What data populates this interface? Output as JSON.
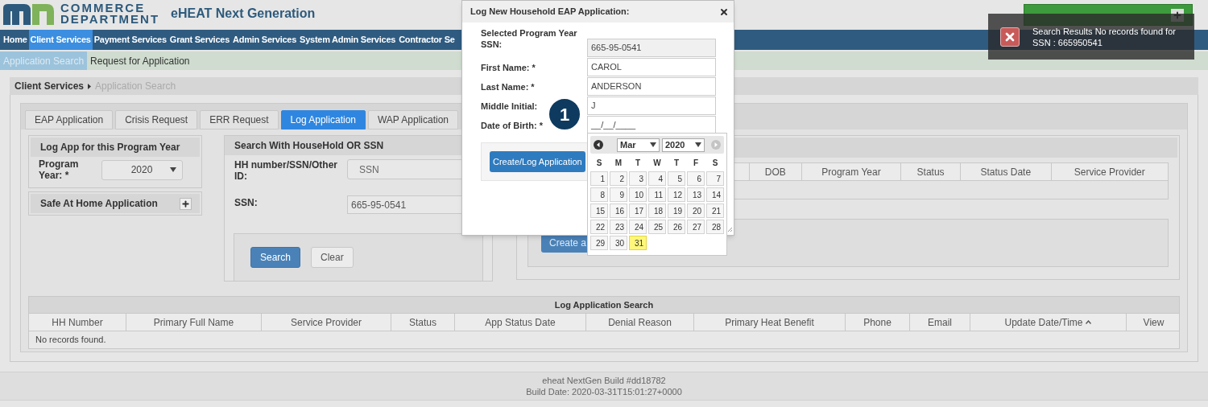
{
  "header": {
    "logo_line_1": "COMMERCE",
    "logo_line_2": "DEPARTMENT",
    "app_title": "eHEAT Next Generation"
  },
  "nav": [
    {
      "label": "Home",
      "selected": false
    },
    {
      "label": "Client Services",
      "selected": true
    },
    {
      "label": "Payment Services",
      "selected": false
    },
    {
      "label": "Grant Services",
      "selected": false
    },
    {
      "label": "Admin Services",
      "selected": false
    },
    {
      "label": "System Admin Services",
      "selected": false
    },
    {
      "label": "Contractor Se",
      "selected": false
    }
  ],
  "subnav": [
    {
      "label": "Application Search",
      "selected": true
    },
    {
      "label": "Request for Application",
      "selected": false
    }
  ],
  "breadcrumb": [
    "Client Services",
    "Application Search"
  ],
  "tabs": [
    {
      "label": "EAP Application",
      "selected": false
    },
    {
      "label": "Crisis Request",
      "selected": false
    },
    {
      "label": "ERR Request",
      "selected": false
    },
    {
      "label": "Log Application",
      "selected": true
    },
    {
      "label": "WAP Application",
      "selected": false
    }
  ],
  "program_year_panel": {
    "title": "Log App for this Program Year",
    "label": "Program Year: *",
    "value": "2020"
  },
  "safe_at_home": {
    "title": "Safe At Home Application",
    "expanded": false
  },
  "search_panel": {
    "title": "Search With HouseHold OR SSN",
    "id_label": "HH number/SSN/Other ID:",
    "id_value": "SSN",
    "ssn_label": "SSN:",
    "ssn_value": "665-95-0541",
    "buttons": [
      {
        "label": "Search",
        "kind": "primary"
      },
      {
        "label": "Clear",
        "kind": "default"
      }
    ]
  },
  "results_panel": {
    "columns": [
      "DOB",
      "Program Year",
      "Status",
      "Status Date",
      "Service Provider"
    ],
    "button": "Create a"
  },
  "log_table": {
    "title": "Log Application Search",
    "columns": [
      {
        "label": "HH Number",
        "sorted": false
      },
      {
        "label": "Primary Full Name",
        "sorted": false
      },
      {
        "label": "Service Provider",
        "sorted": false
      },
      {
        "label": "Status",
        "sorted": false
      },
      {
        "label": "App Status Date",
        "sorted": false
      },
      {
        "label": "Denial Reason",
        "sorted": false
      },
      {
        "label": "Primary Heat Benefit",
        "sorted": false
      },
      {
        "label": "Phone",
        "sorted": false
      },
      {
        "label": "Email",
        "sorted": false
      },
      {
        "label": "Update Date/Time",
        "sorted": true
      },
      {
        "label": "View",
        "sorted": false
      }
    ],
    "empty_message": "No records found."
  },
  "footer": [
    "eheat NextGen Build #dd18782",
    "Build Date: 2020-03-31T15:01:27+0000"
  ],
  "modal": {
    "title": "Log New Household EAP Application:",
    "fields": [
      {
        "label": "Selected Program Year SSN:",
        "value": "665-95-0541",
        "readonly": true
      },
      {
        "label": "First Name: *",
        "value": "CAROL",
        "readonly": false
      },
      {
        "label": "Last Name: *",
        "value": "ANDERSON",
        "readonly": false
      },
      {
        "label": "Middle Initial:",
        "value": "J",
        "readonly": false
      },
      {
        "label": "Date of Birth: *",
        "value": "__/__/____",
        "readonly": false
      }
    ],
    "submit": "Create/Log Application",
    "step_badge": "1"
  },
  "datepicker": {
    "month": "Mar",
    "year": "2020",
    "weekdays": [
      "S",
      "M",
      "T",
      "W",
      "T",
      "F",
      "S"
    ],
    "days": [
      {
        "label": "1",
        "today": false
      },
      {
        "label": "2",
        "today": false
      },
      {
        "label": "3",
        "today": false
      },
      {
        "label": "4",
        "today": false
      },
      {
        "label": "5",
        "today": false
      },
      {
        "label": "6",
        "today": false
      },
      {
        "label": "7",
        "today": false
      },
      {
        "label": "8",
        "today": false
      },
      {
        "label": "9",
        "today": false
      },
      {
        "label": "10",
        "today": false
      },
      {
        "label": "11",
        "today": false
      },
      {
        "label": "12",
        "today": false
      },
      {
        "label": "13",
        "today": false
      },
      {
        "label": "14",
        "today": false
      },
      {
        "label": "15",
        "today": false
      },
      {
        "label": "16",
        "today": false
      },
      {
        "label": "17",
        "today": false
      },
      {
        "label": "18",
        "today": false
      },
      {
        "label": "19",
        "today": false
      },
      {
        "label": "20",
        "today": false
      },
      {
        "label": "21",
        "today": false
      },
      {
        "label": "22",
        "today": false
      },
      {
        "label": "23",
        "today": false
      },
      {
        "label": "24",
        "today": false
      },
      {
        "label": "25",
        "today": false
      },
      {
        "label": "26",
        "today": false
      },
      {
        "label": "27",
        "today": false
      },
      {
        "label": "28",
        "today": false
      },
      {
        "label": "29",
        "today": false
      },
      {
        "label": "30",
        "today": false
      },
      {
        "label": "31",
        "today": true
      }
    ]
  },
  "toast": {
    "message": "Search Results No records found for SSN : 665950541"
  }
}
